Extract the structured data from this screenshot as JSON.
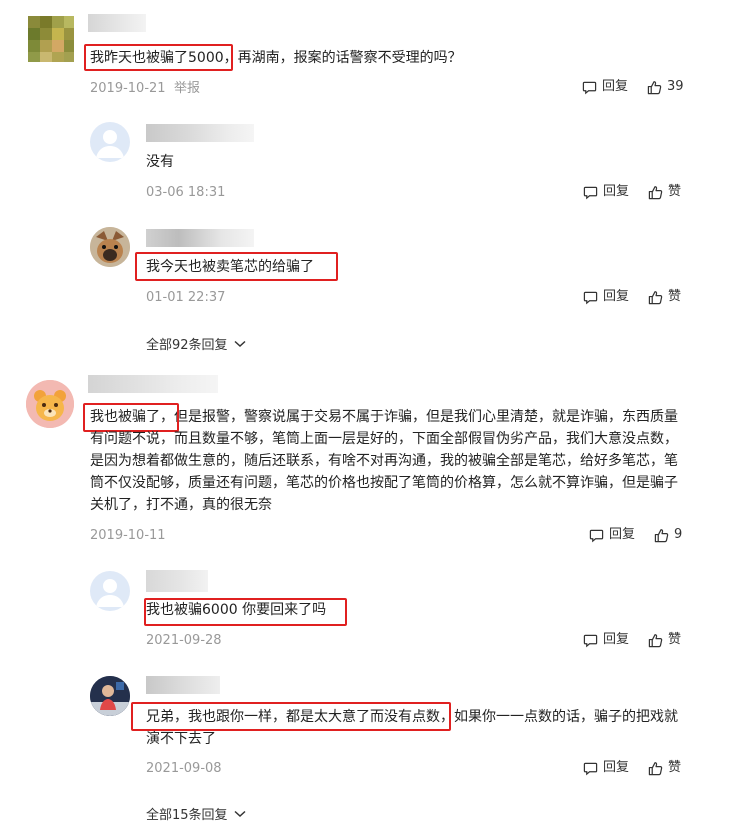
{
  "comments": [
    {
      "text_hl": "我昨天也被骗了5000，",
      "text_rest": "再湖南，报案的话警察不受理的吗？",
      "date": "2019-10-21",
      "report": "举报",
      "reply_label": "回复",
      "likes": "39",
      "replies": [
        {
          "text": "没有",
          "date": "03-06 18:31",
          "reply_label": "回复",
          "like_label": "赞"
        },
        {
          "text": "我今天也被卖笔芯的给骗了",
          "date": "01-01 22:37",
          "reply_label": "回复",
          "like_label": "赞"
        }
      ],
      "all_replies": "全部92条回复"
    },
    {
      "text_line1_hl": "我也被骗了，",
      "text_line1_rest": "但是报警，警察说属于交易不属于诈骗，但是我们心里清楚，就是诈骗，东西质量",
      "text_line2": "有问题不说，而且数量不够，笔筒上面一层是好的，下面全部假冒伪劣产品，我们大意没点数，",
      "text_line3": "是因为想着都做生意的，随后还联系，有啥不对再沟通，我的被骗全部是笔芯，给好多笔芯，笔",
      "text_line4": "筒不仅没配够，质量还有问题，笔芯的价格也按配了笔筒的价格算，怎么就不算诈骗，但是骗子",
      "text_line5": "关机了，打不通，真的很无奈",
      "date": "2019-10-11",
      "reply_label": "回复",
      "likes": "9",
      "replies": [
        {
          "text": "我也被骗6000 你要回来了吗",
          "date": "2021-09-28",
          "reply_label": "回复",
          "like_label": "赞"
        },
        {
          "text_hl": "兄弟，我也跟你一样，都是太大意了而没有点数，",
          "text_rest": "如果你一一点数的话，骗子的把戏就",
          "text_line2": "演不下去了",
          "date": "2021-09-08",
          "reply_label": "回复",
          "like_label": "赞"
        }
      ],
      "all_replies": "全部15条回复"
    }
  ],
  "icons": {
    "reply": "comment-bubble-icon",
    "like": "thumbs-up-icon",
    "expand": "chevron-down-icon"
  },
  "colors": {
    "highlight_border": "#e02020",
    "meta": "#999999"
  }
}
